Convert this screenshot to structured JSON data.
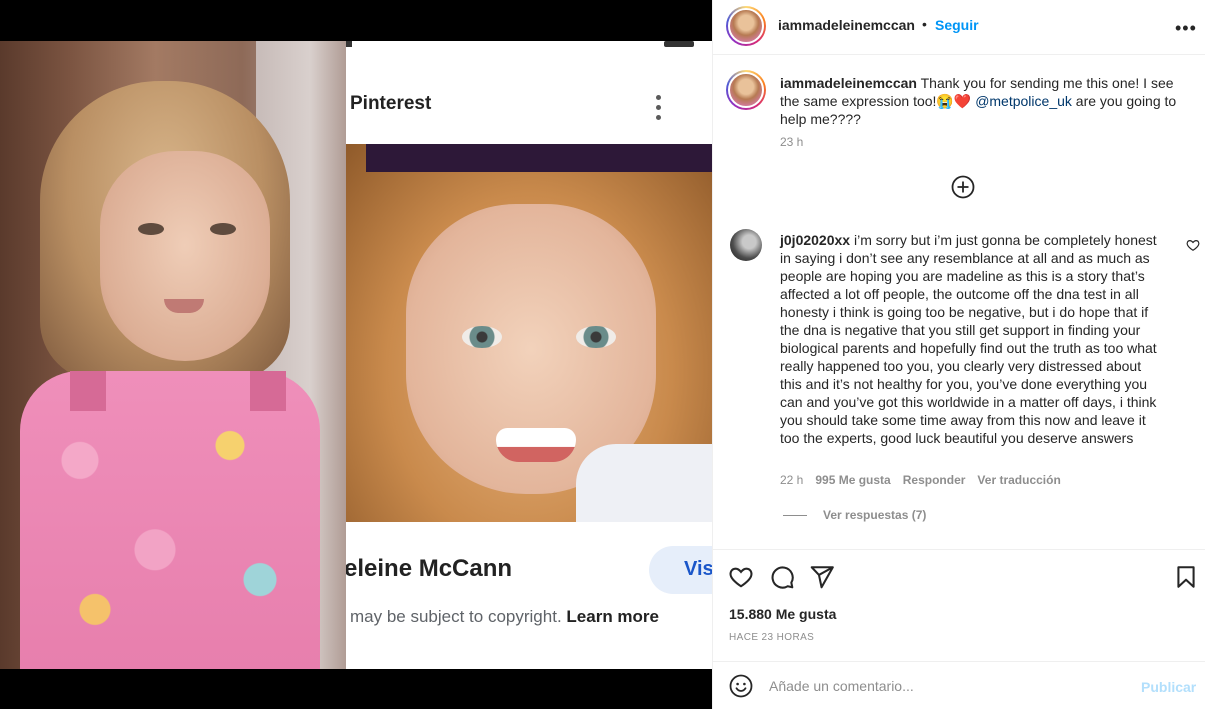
{
  "media": {
    "pin_header": "Pinterest",
    "pin_title": "eleine McCann",
    "visit_label": "Vis",
    "copyright_text": "may be subject to copyright.",
    "copyright_link": "Learn more"
  },
  "header": {
    "username": "iammadeleinemccan",
    "separator": "•",
    "follow_label": "Seguir",
    "more_label": "•••"
  },
  "caption": {
    "username": "iammadeleinemccan",
    "text_before": "Thank you for sending me this one! I see the same expression too!😭❤️",
    "mention": "@metpolice_uk",
    "text_after": "are you going to help me????",
    "time": "23 h"
  },
  "comment": {
    "username": "j0j02020xx",
    "text": "i’m sorry but i’m just gonna be completely honest in saying i don’t see any resemblance at all and as much as people are hoping you are madeline as this is a story that’s affected a lot off people, the outcome off the dna test in all honesty i think is going too be negative, but i do hope that if the dna is negative that you still get support in finding your biological parents and hopefully find out the truth as too what really happened too you, you clearly very distressed about this and it’s not healthy for you, you’ve done everything you can and you’ve got this worldwide in a matter off days, i think you should take some time away from this now and leave it too the experts, good luck beautiful you deserve answers",
    "time": "22 h",
    "likes": "995 Me gusta",
    "reply_label": "Responder",
    "translate_label": "Ver traducción",
    "view_replies": "Ver respuestas (7)"
  },
  "actions": {
    "likes": "15.880 Me gusta",
    "ago": "HACE 23 HORAS"
  },
  "add_comment": {
    "placeholder": "Añade un comentario...",
    "publish_label": "Publicar"
  },
  "icons": {
    "like": "heart-icon",
    "comment": "comment-icon",
    "share": "send-icon",
    "save": "bookmark-icon",
    "emoji": "emoji-icon",
    "load_more": "plus-circle-icon"
  },
  "colors": {
    "accent": "#0095f6",
    "mention": "#00376b",
    "muted": "#8e8e8e",
    "publish_disabled": "#b2dffc"
  }
}
